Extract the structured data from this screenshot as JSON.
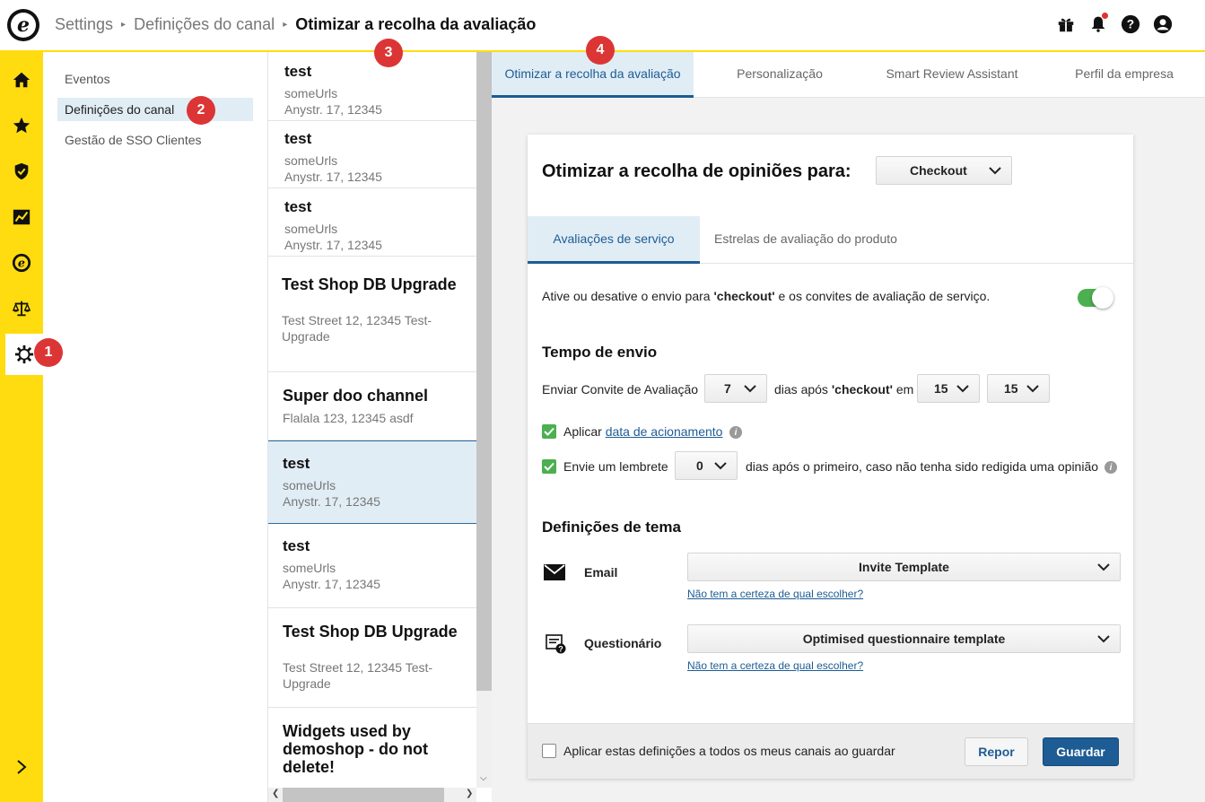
{
  "header": {
    "breadcrumb": [
      "Settings",
      "Definições do canal",
      "Otimizar a recolha da avaliação"
    ]
  },
  "badges": [
    "1",
    "2",
    "3",
    "4"
  ],
  "subnav": {
    "items": [
      "Eventos",
      "Definições do canal",
      "Gestão de SSO Clientes"
    ]
  },
  "channels": [
    {
      "name": "test",
      "line1": "someUrls",
      "line2": "Anystr. 17, 12345"
    },
    {
      "name": "test",
      "line1": "someUrls",
      "line2": "Anystr. 17, 12345"
    },
    {
      "name": "test",
      "line1": "someUrls",
      "line2": "Anystr. 17, 12345"
    },
    {
      "name": "Test Shop DB Upgrade",
      "line1": "Test Street 12, 12345 Test-",
      "line2": "Upgrade"
    },
    {
      "name": "Super doo channel",
      "line1": "Flalala 123, 12345 asdf",
      "line2": ""
    },
    {
      "name": "test",
      "line1": "someUrls",
      "line2": "Anystr. 17, 12345"
    },
    {
      "name": "test",
      "line1": "someUrls",
      "line2": "Anystr. 17, 12345"
    },
    {
      "name": "Test Shop DB Upgrade",
      "line1": "Test Street 12, 12345 Test-",
      "line2": "Upgrade"
    },
    {
      "name_lines": [
        "Widgets used by",
        "demoshop - do not",
        "delete!"
      ]
    }
  ],
  "tabs": [
    "Otimizar a recolha da avaliação",
    "Personalização",
    "Smart Review Assistant",
    "Perfil da empresa"
  ],
  "card": {
    "title": "Otimizar a recolha de opiniões para:",
    "trigger_select": "Checkout",
    "subtabs": [
      "Avaliações de serviço",
      "Estrelas de avaliação do produto"
    ],
    "toggle_text_pre": "Ative ou desative o envio para ",
    "toggle_text_bold": "'checkout'",
    "toggle_text_post": " e os convites de avaliação de serviço.",
    "toggle_on": true,
    "send_time_heading": "Tempo de envio",
    "send_invite_label": "Enviar Convite de Avaliação",
    "days_value": "7",
    "days_after_pre": "dias após ",
    "days_after_bold": "'checkout'",
    "days_after_post": " em",
    "hour_value": "15",
    "minute_value": "15",
    "apply_label": "Aplicar ",
    "apply_link": "data de acionamento",
    "apply_checked": true,
    "reminder_label": "Envie um lembrete",
    "reminder_value": "0",
    "reminder_after": "dias após o primeiro, caso não tenha sido redigida uma opinião",
    "reminder_checked": true,
    "theme_heading": "Definições de tema",
    "email_label": "Email",
    "email_template": "Invite Template",
    "help_link_1": "Não tem a certeza de qual escolher?",
    "questionnaire_label": "Questionário",
    "questionnaire_template": "Optimised questionnaire template",
    "help_link_2": "Não tem a certeza de qual escolher?",
    "apply_all_label": "Aplicar estas definições a todos os meus canais ao guardar",
    "apply_all_checked": false,
    "reset_button": "Repor",
    "save_button": "Guardar"
  },
  "colors": {
    "brand_yellow": "#ffdc0f",
    "accent_blue": "#1d5c94",
    "selection_bg": "#e1edf5",
    "badge_red": "#dc3535",
    "toggle_green": "#4caf50"
  }
}
